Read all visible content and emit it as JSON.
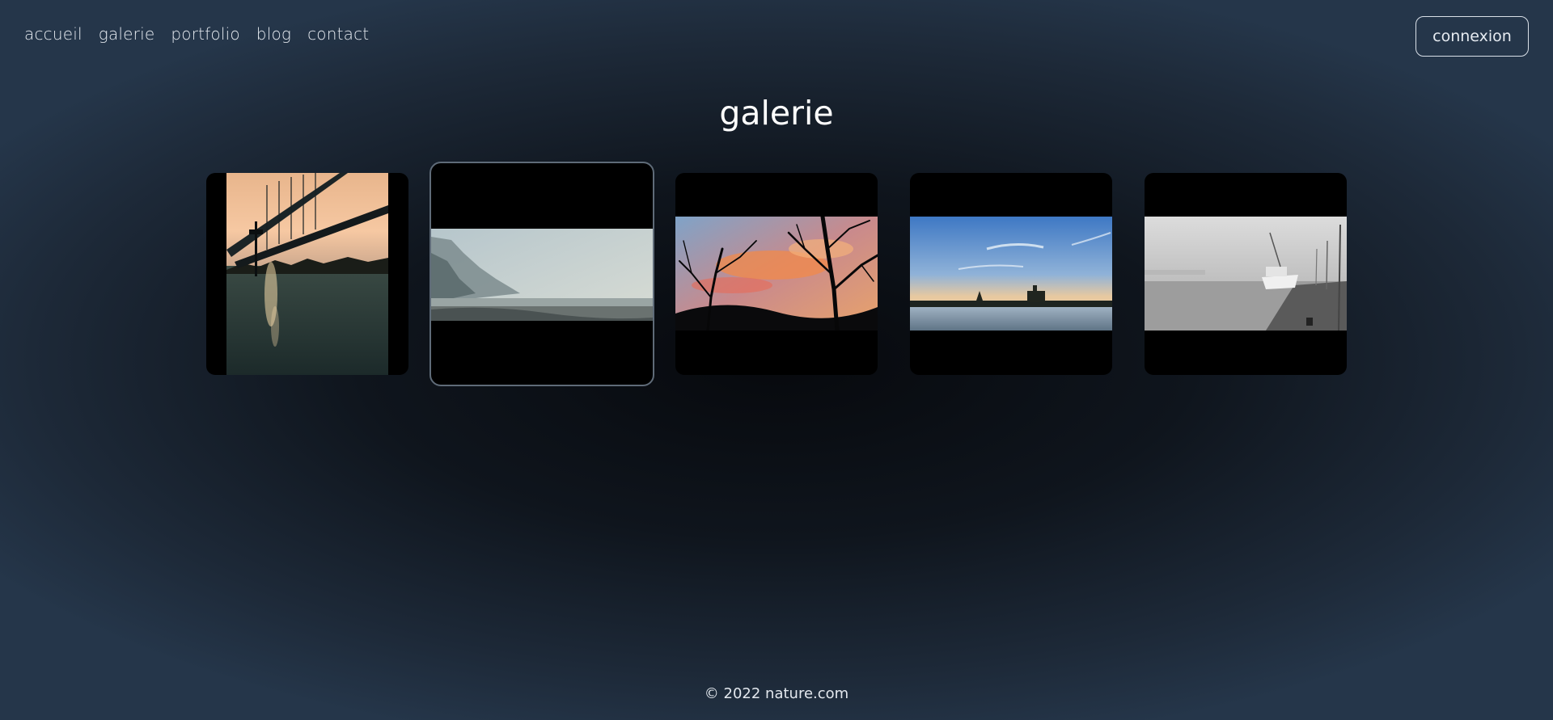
{
  "nav": {
    "items": [
      {
        "label": "accueil"
      },
      {
        "label": "galerie"
      },
      {
        "label": "portfolio"
      },
      {
        "label": "blog"
      },
      {
        "label": "contact"
      }
    ]
  },
  "header": {
    "login_label": "connexion"
  },
  "main": {
    "title": "galerie",
    "photos": [
      {
        "subject": "bridge at sunset over river",
        "selected": false
      },
      {
        "subject": "misty white cliffs and beach",
        "selected": true
      },
      {
        "subject": "bare trees against colorful sunset sky",
        "selected": false
      },
      {
        "subject": "river with ruins at dusk",
        "selected": false
      },
      {
        "subject": "boat docked at foggy pier",
        "selected": false
      }
    ]
  },
  "footer": {
    "copyright": "© 2022 nature.com"
  },
  "colors": {
    "background_center": "#07090d",
    "background_edge": "#25364a",
    "text": "#e6ebf1",
    "card": "#000000",
    "selected_border": "#5f6b78"
  }
}
